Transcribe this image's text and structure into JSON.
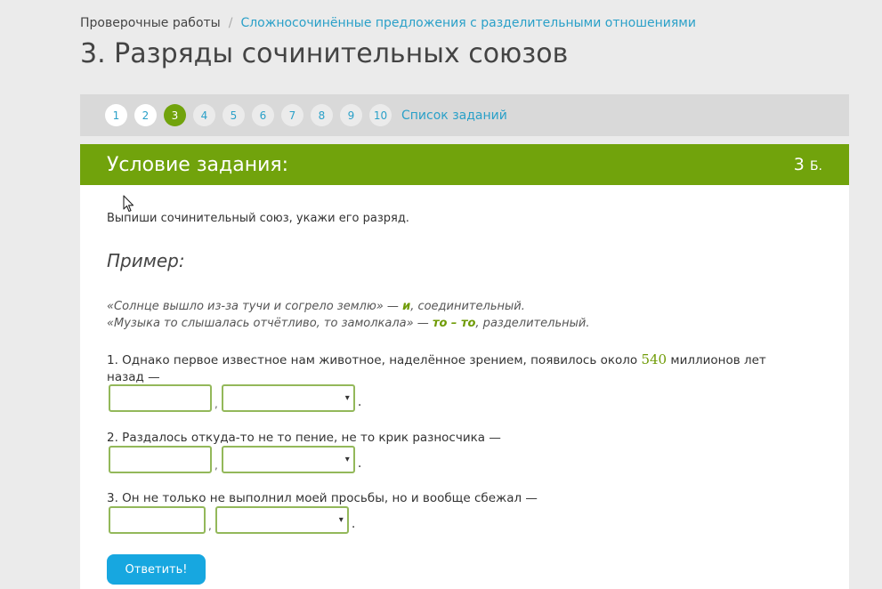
{
  "breadcrumb": {
    "root": "Проверочные работы",
    "separator": "/",
    "current": "Сложносочинённые предложения с разделительными отношениями"
  },
  "page_title": "3. Разряды сочинительных союзов",
  "pager": {
    "pages": [
      "1",
      "2",
      "3",
      "4",
      "5",
      "6",
      "7",
      "8",
      "9",
      "10"
    ],
    "active_page": "3",
    "task_list_label": "Список заданий"
  },
  "card": {
    "title": "Условие задания:",
    "points": "3",
    "points_unit": "Б."
  },
  "instruction": "Выпиши сочинительный союз, укажи его разряд.",
  "example": {
    "heading": "Пример:",
    "line1": {
      "quote": "«Солнце вышло из-за тучи и согрело землю» — ",
      "answer": "и",
      "rest": ", соединительный."
    },
    "line2": {
      "quote": "«Музыка то слышалась отчётливо, то замолкала» — ",
      "answer": "то – то",
      "rest": ", разделительный."
    }
  },
  "questions": [
    {
      "text_before": "1. Однако первое известное нам животное, наделённое зрением, появилось около ",
      "number": "540",
      "text_after": " миллионов лет назад —",
      "input_value": "",
      "select_value": ""
    },
    {
      "text": "2. Раздалось откуда-то не то пение, не то крик разносчика —",
      "input_value": "",
      "select_value": ""
    },
    {
      "text": "3. Он не только не выполнил моей просьбы, но и вообще сбежал —",
      "input_value": "",
      "select_value": ""
    }
  ],
  "separators": {
    "comma": ",",
    "dot": "."
  },
  "select_caret": "▾",
  "submit_label": "Ответить!",
  "colors": {
    "accent_green": "#71a30c",
    "link_blue": "#2aa0c8",
    "button_blue": "#17a7e0"
  }
}
